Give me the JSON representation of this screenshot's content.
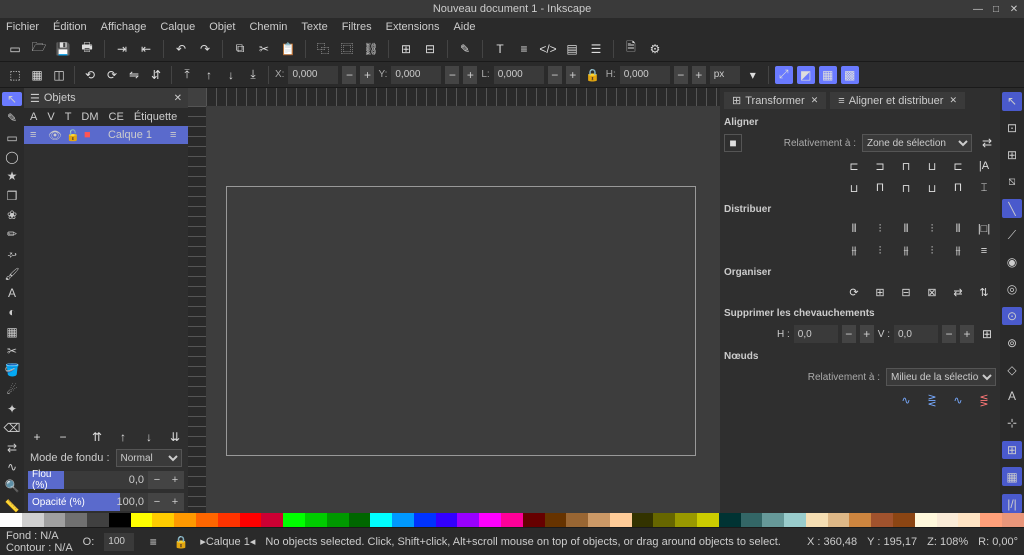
{
  "title": "Nouveau document 1 - Inkscape",
  "menu": [
    "Fichier",
    "Édition",
    "Affichage",
    "Calque",
    "Objet",
    "Chemin",
    "Texte",
    "Filtres",
    "Extensions",
    "Aide"
  ],
  "coords": {
    "xLabel": "X:",
    "xVal": "0,000",
    "yLabel": "Y:",
    "yVal": "0,000",
    "wLabel": "L:",
    "wVal": "0,000",
    "hLabel": "H:",
    "hVal": "0,000",
    "unit": "px"
  },
  "objectsPanel": {
    "tab": "Objets",
    "headers": [
      "A",
      "V",
      "T",
      "DM",
      "CE",
      "Étiquette"
    ],
    "layer": "Calque 1",
    "blendLabel": "Mode de fondu :",
    "blendValue": "Normal",
    "blur": {
      "label": "Flou (%)",
      "value": "0,0"
    },
    "opacity": {
      "label": "Opacité (%)",
      "value": "100,0"
    }
  },
  "rightPanel": {
    "tabs": [
      "Transformer",
      "Aligner et distribuer"
    ],
    "align": {
      "title": "Aligner",
      "relLabel": "Relativement à :",
      "relValue": "Zone de sélection"
    },
    "distribute": "Distribuer",
    "organize": "Organiser",
    "overlap": "Supprimer les chevauchements",
    "hv": {
      "hLabel": "H :",
      "hVal": "0,0",
      "vLabel": "V :",
      "vVal": "0,0"
    },
    "nodes": {
      "title": "Nœuds",
      "relLabel": "Relativement à :",
      "relValue": "Milieu de la sélection"
    }
  },
  "status": {
    "fill": "Fond :",
    "fillV": "N/A",
    "stroke": "Contour :",
    "strokeV": "N/A",
    "oLabel": "O:",
    "oVal": "100",
    "layer": "Calque 1",
    "msg": "No objects selected. Click, Shift+click, Alt+scroll mouse on top of objects, or drag around objects to select.",
    "x": "X :",
    "xv": "360,48",
    "y": "Y :",
    "yv": "195,17",
    "z": "Z:",
    "zv": "108%",
    "r": "R:",
    "rv": "0,00°"
  },
  "palette": [
    "#ffffff",
    "#d0d0d0",
    "#a0a0a0",
    "#707070",
    "#404040",
    "#000000",
    "#ffff00",
    "#ffcc00",
    "#ff9900",
    "#ff6600",
    "#ff3300",
    "#ff0000",
    "#cc0033",
    "#00ff00",
    "#00cc00",
    "#009900",
    "#006600",
    "#00ffff",
    "#0099ff",
    "#0033ff",
    "#3300ff",
    "#9900ff",
    "#ff00ff",
    "#ff0099",
    "#660000",
    "#663300",
    "#996633",
    "#cc9966",
    "#ffcc99",
    "#333300",
    "#666600",
    "#999900",
    "#cccc00",
    "#003333",
    "#336666",
    "#669999",
    "#99cccc",
    "#f5deb3",
    "#deb887",
    "#cd853f",
    "#a0522d",
    "#8b4513",
    "#fff8dc",
    "#faebd7",
    "#ffe4c4",
    "#ffa07a",
    "#e9967a"
  ]
}
